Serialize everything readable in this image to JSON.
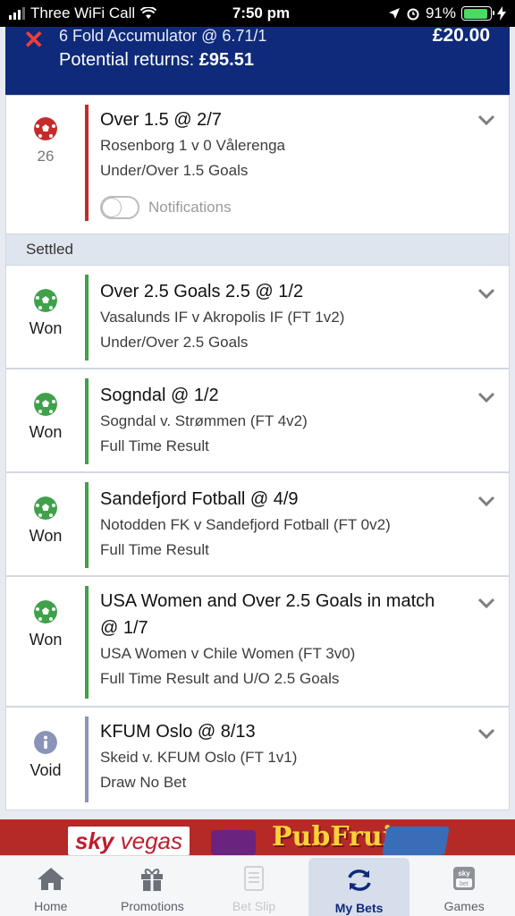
{
  "status_bar": {
    "carrier": "Three WiFi Call",
    "time": "7:50 pm",
    "battery": "91%"
  },
  "accumulator": {
    "title": "6 Fold Accumulator @ 6.71/1",
    "stake": "£20.00",
    "returns_label": "Potential returns:",
    "returns_value": "£95.51"
  },
  "open_bet": {
    "minute": "26",
    "title": "Over 1.5 @ 2/7",
    "match": "Rosenborg 1 v 0 Vålerenga",
    "market": "Under/Over 1.5 Goals",
    "notifications_label": "Notifications"
  },
  "settled_label": "Settled",
  "settled_bets": [
    {
      "status": "Won",
      "title": "Over 2.5 Goals 2.5 @ 1/2",
      "match": "Vasalunds IF v Akropolis IF (FT 1v2)",
      "market": "Under/Over 2.5 Goals"
    },
    {
      "status": "Won",
      "title": "Sogndal @ 1/2",
      "match": "Sogndal v. Strømmen (FT 4v2)",
      "market": "Full Time Result"
    },
    {
      "status": "Won",
      "title": "Sandefjord Fotball @ 4/9",
      "match": "Notodden FK v Sandefjord Fotball (FT 0v2)",
      "market": "Full Time Result"
    },
    {
      "status": "Won",
      "title": "USA Women and Over 2.5 Goals in match @ 1/7",
      "match": "USA Women v Chile Women (FT 3v0)",
      "market": "Full Time Result and U/O 2.5 Goals"
    },
    {
      "status": "Void",
      "title": "KFUM Oslo @ 8/13",
      "match": "Skeid v. KFUM Oslo (FT 1v1)",
      "market": "Draw No Bet"
    }
  ],
  "banner": {
    "brand_sky": "sky",
    "brand_vegas": "vegas",
    "game": "PubFruit"
  },
  "tabs": [
    {
      "label": "Home",
      "icon": "home-icon"
    },
    {
      "label": "Promotions",
      "icon": "gift-icon"
    },
    {
      "label": "Bet Slip",
      "icon": "betslip-icon"
    },
    {
      "label": "My Bets",
      "icon": "refresh-icon"
    },
    {
      "label": "Games",
      "icon": "skybet-icon"
    }
  ],
  "colors": {
    "header_bg": "#0f2a7a",
    "open_bar": "#c62b2b",
    "won_bar": "#3fa14a",
    "void_bar": "#8a94b8"
  }
}
